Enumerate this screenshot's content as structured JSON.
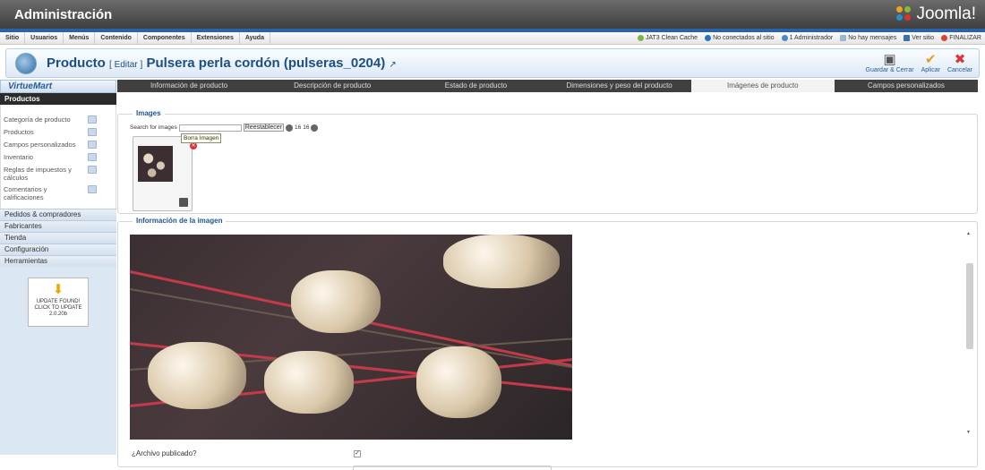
{
  "header": {
    "title": "Administración",
    "brand": "Joomla!"
  },
  "menu": {
    "items": [
      "Sitio",
      "Usuarios",
      "Menús",
      "Contenido",
      "Componentes",
      "Extensiones",
      "Ayuda"
    ],
    "status": {
      "cache": "JAT3 Clean Cache",
      "offline": "No conectados al sitio",
      "admins": "1 Administrador",
      "messages": "No hay mensajes",
      "view_site": "Ver sitio",
      "logout": "FINALIZAR"
    }
  },
  "page": {
    "title": "Producto",
    "edit_label": "[ Editar ]",
    "product_name": "Pulsera perla cordón (pulseras_0204)"
  },
  "toolbar": {
    "save_close": "Guardar & Cerrar",
    "apply": "Aplicar",
    "cancel": "Cancelar"
  },
  "sidebar": {
    "brand": "VirtueMart",
    "section": "Productos",
    "items": [
      "Categoría de producto",
      "Productos",
      "Campos personalizados",
      "Inventario",
      "Reglas de impuestos y cálculos",
      "Comentarios y calificaciones"
    ],
    "categories": [
      "Pedidos & compradores",
      "Fabricantes",
      "Tienda",
      "Configuración",
      "Herramientas"
    ],
    "update": {
      "line1": "UPDATE FOUND!",
      "line2": "CLICK TO UPDATE",
      "version": "2.0.20b"
    }
  },
  "tabs": [
    {
      "label": "Información de producto",
      "active": false
    },
    {
      "label": "Descripción de producto",
      "active": false
    },
    {
      "label": "Estado de producto",
      "active": false
    },
    {
      "label": "Dimensiones y peso del producto",
      "active": false
    },
    {
      "label": "Imágenes de producto",
      "active": true
    },
    {
      "label": "Campos personalizados",
      "active": false
    }
  ],
  "images": {
    "legend": "Images",
    "search_label": "Search for images",
    "reset_label": "Reestablecer",
    "count_a": "16",
    "count_b": "16",
    "tooltip": "Borra Imagen"
  },
  "image_info": {
    "legend": "Información de la imagen",
    "published_label": "¿Archivo publicado?"
  },
  "colors": {
    "accent": "#1f5591",
    "tab_bg": "#404040",
    "sidebar_bg": "#dbe7f3"
  }
}
